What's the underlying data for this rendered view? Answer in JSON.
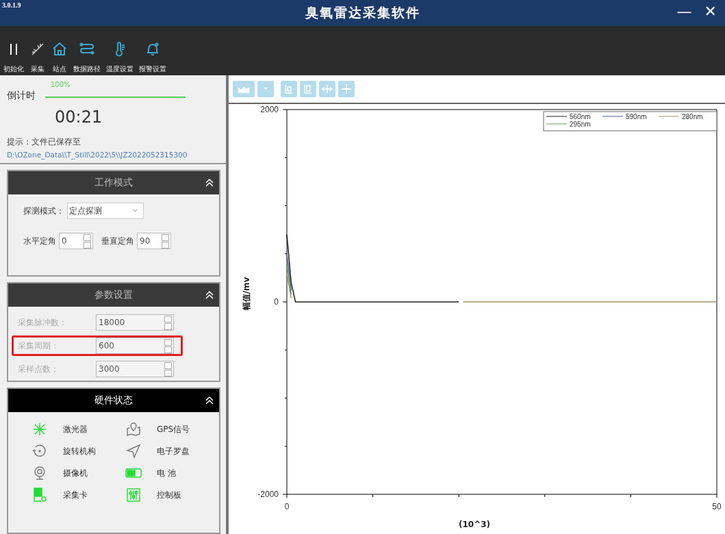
{
  "window": {
    "version": "3.0.1.9",
    "title": "臭氧雷达采集软件",
    "controls": [
      "—",
      "✕"
    ]
  },
  "toolbar": [
    {
      "label": "初始化",
      "kind": "pause"
    },
    {
      "label": "采集",
      "kind": "spark"
    },
    {
      "label": "站点",
      "kind": "home"
    },
    {
      "label": "数据路径",
      "kind": "path"
    },
    {
      "label": "温度设置",
      "kind": "thermo"
    },
    {
      "label": "报警设置",
      "kind": "bell"
    }
  ],
  "countdown": {
    "label": "倒计时",
    "progress_text": "100%",
    "level": 1,
    "time": "00:21",
    "hint": "提示：文件已保存至",
    "path": "D:\\OZone_Data\\\\T_Still\\2022\\5\\\\JZ2022052315300"
  },
  "work_mode": {
    "title": "工作模式",
    "mode_label": "探测模式：",
    "mode_value": "定点探测",
    "h_label": "水平定角",
    "h_value": "0",
    "v_label": "垂直定角",
    "v_value": "90"
  },
  "params": {
    "title": "参数设置",
    "rows": [
      {
        "label": "采集脉冲数：",
        "value": "18000",
        "disabled": true,
        "highlighted": false
      },
      {
        "label": "采集周期：",
        "value": "600",
        "disabled": true,
        "highlighted": true
      },
      {
        "label": "采样点数：",
        "value": "3000",
        "disabled": true,
        "highlighted": false
      }
    ]
  },
  "hardware": {
    "title": "硬件状态",
    "items": [
      {
        "label": "激光器",
        "kind": "laser",
        "on": true
      },
      {
        "label": "GPS信号",
        "kind": "gps",
        "on": false
      },
      {
        "label": "旋转机构",
        "kind": "rotate",
        "on": false
      },
      {
        "label": "电子罗盘",
        "kind": "compass",
        "on": false
      },
      {
        "label": "摄像机",
        "kind": "camera",
        "on": false
      },
      {
        "label": "电 池",
        "kind": "battery",
        "on": true
      },
      {
        "label": "采集卡",
        "kind": "card",
        "on": true
      },
      {
        "label": "控制板",
        "kind": "board",
        "on": true
      }
    ]
  },
  "chart": {
    "chart_data": {
      "type": "line",
      "ylabel": "幅值/mv",
      "xlabel": "(10^3)",
      "legend": "top-right",
      "x": [
        0,
        0.5,
        1,
        20,
        20.5,
        30,
        40,
        50
      ],
      "xlim": [
        0,
        50
      ],
      "ylim": [
        -2000,
        2000
      ],
      "xticks": [
        0,
        50
      ],
      "yticks": [
        -2000,
        0,
        2000
      ],
      "series": [
        {
          "name": "560nm",
          "color": "#202020",
          "values": [
            700,
            200,
            0,
            0,
            null,
            null,
            null,
            null
          ]
        },
        {
          "name": "590nm",
          "color": "#5060a0",
          "values": [
            500,
            120,
            null,
            null,
            null,
            null,
            null,
            null
          ]
        },
        {
          "name": "280nm",
          "color": "#a09070",
          "values": [
            300,
            40,
            null,
            null,
            0,
            0,
            0,
            0
          ]
        },
        {
          "name": "295nm",
          "color": "#60a060",
          "values": [
            400,
            80,
            null,
            null,
            null,
            null,
            null,
            null
          ]
        }
      ]
    }
  }
}
